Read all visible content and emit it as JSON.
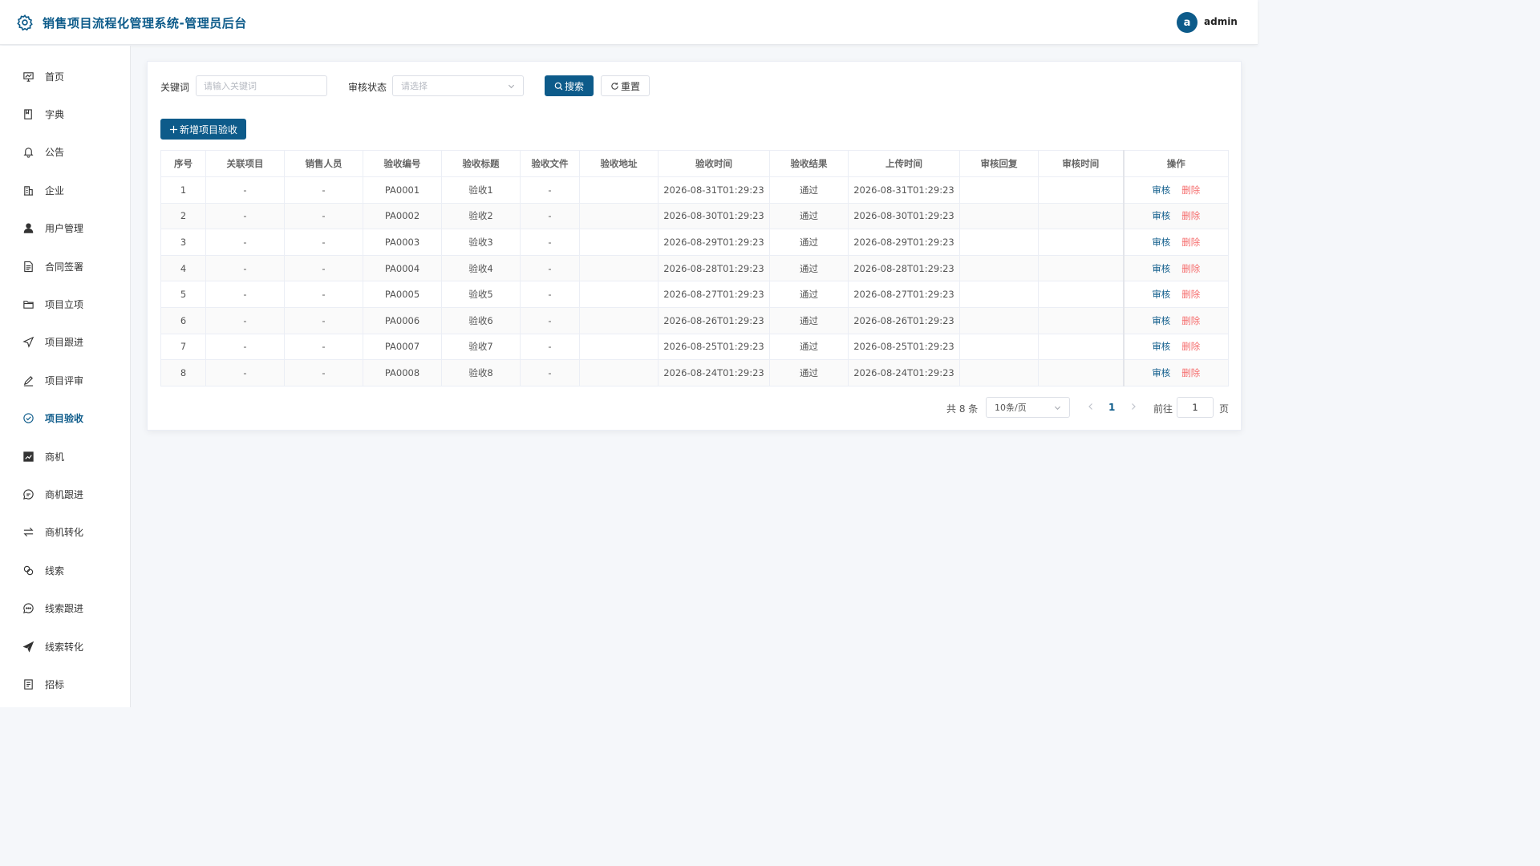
{
  "header": {
    "title": "销售项目流程化管理系统-管理员后台",
    "avatar_letter": "a",
    "username": "admin",
    "accent_color": "#0d5b8a"
  },
  "sidebar": {
    "active": "项目验收",
    "items": [
      {
        "label": "首页",
        "icon": "dashboard-icon"
      },
      {
        "label": "字典",
        "icon": "book-icon"
      },
      {
        "label": "公告",
        "icon": "bell-icon"
      },
      {
        "label": "企业",
        "icon": "building-icon"
      },
      {
        "label": "用户管理",
        "icon": "user-icon"
      },
      {
        "label": "合同签署",
        "icon": "document-icon"
      },
      {
        "label": "项目立项",
        "icon": "folder-icon"
      },
      {
        "label": "项目跟进",
        "icon": "send-icon"
      },
      {
        "label": "项目评审",
        "icon": "edit-icon"
      },
      {
        "label": "项目验收",
        "icon": "check-circle-icon"
      },
      {
        "label": "商机",
        "icon": "chart-icon"
      },
      {
        "label": "商机跟进",
        "icon": "chat-icon"
      },
      {
        "label": "商机转化",
        "icon": "switch-icon"
      },
      {
        "label": "线索",
        "icon": "link-icon"
      },
      {
        "label": "线索跟进",
        "icon": "chat-dots-icon"
      },
      {
        "label": "线索转化",
        "icon": "paper-plane-icon"
      },
      {
        "label": "招标",
        "icon": "list-icon"
      }
    ]
  },
  "filters": {
    "keyword_label": "关键词",
    "keyword_placeholder": "请输入关键词",
    "keyword_value": "",
    "status_label": "审核状态",
    "status_placeholder": "请选择",
    "search_label": "搜索",
    "reset_label": "重置"
  },
  "toolbar": {
    "add_label": "新增项目验收"
  },
  "table": {
    "columns": [
      "序号",
      "关联项目",
      "销售人员",
      "验收编号",
      "验收标题",
      "验收文件",
      "验收地址",
      "验收时间",
      "验收结果",
      "上传时间",
      "审核回复",
      "审核时间",
      "操作"
    ],
    "rows": [
      [
        "1",
        "-",
        "-",
        "PA0001",
        "验收1",
        "-",
        "",
        "2026-08-31T01:29:23",
        "通过",
        "2026-08-31T01:29:23",
        "",
        ""
      ],
      [
        "2",
        "-",
        "-",
        "PA0002",
        "验收2",
        "-",
        "",
        "2026-08-30T01:29:23",
        "通过",
        "2026-08-30T01:29:23",
        "",
        ""
      ],
      [
        "3",
        "-",
        "-",
        "PA0003",
        "验收3",
        "-",
        "",
        "2026-08-29T01:29:23",
        "通过",
        "2026-08-29T01:29:23",
        "",
        ""
      ],
      [
        "4",
        "-",
        "-",
        "PA0004",
        "验收4",
        "-",
        "",
        "2026-08-28T01:29:23",
        "通过",
        "2026-08-28T01:29:23",
        "",
        ""
      ],
      [
        "5",
        "-",
        "-",
        "PA0005",
        "验收5",
        "-",
        "",
        "2026-08-27T01:29:23",
        "通过",
        "2026-08-27T01:29:23",
        "",
        ""
      ],
      [
        "6",
        "-",
        "-",
        "PA0006",
        "验收6",
        "-",
        "",
        "2026-08-26T01:29:23",
        "通过",
        "2026-08-26T01:29:23",
        "",
        ""
      ],
      [
        "7",
        "-",
        "-",
        "PA0007",
        "验收7",
        "-",
        "",
        "2026-08-25T01:29:23",
        "通过",
        "2026-08-25T01:29:23",
        "",
        ""
      ],
      [
        "8",
        "-",
        "-",
        "PA0008",
        "验收8",
        "-",
        "",
        "2026-08-24T01:29:23",
        "通过",
        "2026-08-24T01:29:23",
        "",
        ""
      ]
    ],
    "audit_label": "审核",
    "delete_label": "删除"
  },
  "pagination": {
    "total_text": "共 8 条",
    "page_size": "10条/页",
    "current_page": "1",
    "goto_label": "前往",
    "goto_value": "1",
    "page_suffix": "页"
  }
}
